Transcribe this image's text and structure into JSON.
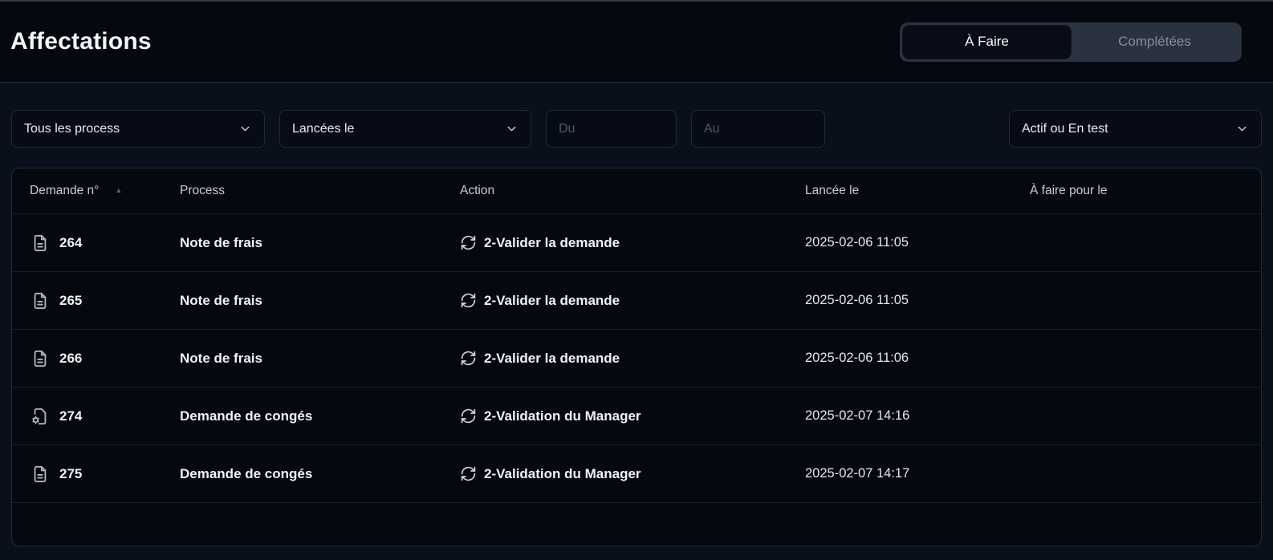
{
  "page": {
    "title": "Affectations"
  },
  "tabs": {
    "todo": "À Faire",
    "completed": "Complétées",
    "active_tab": "À Faire"
  },
  "filters": {
    "process": {
      "value": "Tous les process"
    },
    "launched": {
      "value": "Lancées le"
    },
    "date_from": {
      "placeholder": "Du",
      "value": ""
    },
    "date_to": {
      "placeholder": "Au",
      "value": ""
    },
    "status": {
      "value": "Actif ou En test"
    }
  },
  "table": {
    "columns": [
      "Demande n°",
      "Process",
      "Action",
      "Lancée le",
      "À faire pour le"
    ],
    "sort_column": "Demande n°",
    "sort_direction": "asc",
    "rows": [
      {
        "id": "264",
        "icon": "file-lines-icon",
        "process": "Note de frais",
        "action": "2-Valider la demande",
        "launched": "2025-02-06 11:05",
        "due": ""
      },
      {
        "id": "265",
        "icon": "file-lines-icon",
        "process": "Note de frais",
        "action": "2-Valider la demande",
        "launched": "2025-02-06 11:05",
        "due": ""
      },
      {
        "id": "266",
        "icon": "file-lines-icon",
        "process": "Note de frais",
        "action": "2-Valider la demande",
        "launched": "2025-02-06 11:06",
        "due": ""
      },
      {
        "id": "274",
        "icon": "file-gear-icon",
        "process": "Demande de congés",
        "action": "2-Validation du Manager",
        "launched": "2025-02-07 14:16",
        "due": ""
      },
      {
        "id": "275",
        "icon": "file-lines-icon",
        "process": "Demande de congés",
        "action": "2-Validation du Manager",
        "launched": "2025-02-07 14:17",
        "due": ""
      }
    ]
  },
  "colors": {
    "background": "#0a0f1c",
    "header_background": "#05080f",
    "card_background": "#04080f",
    "control_border": "#212938",
    "active_tab_background": "#080c16",
    "segmented_background": "#2a313f",
    "text_primary": "#f0f2f6",
    "text_muted": "#868e9c"
  }
}
